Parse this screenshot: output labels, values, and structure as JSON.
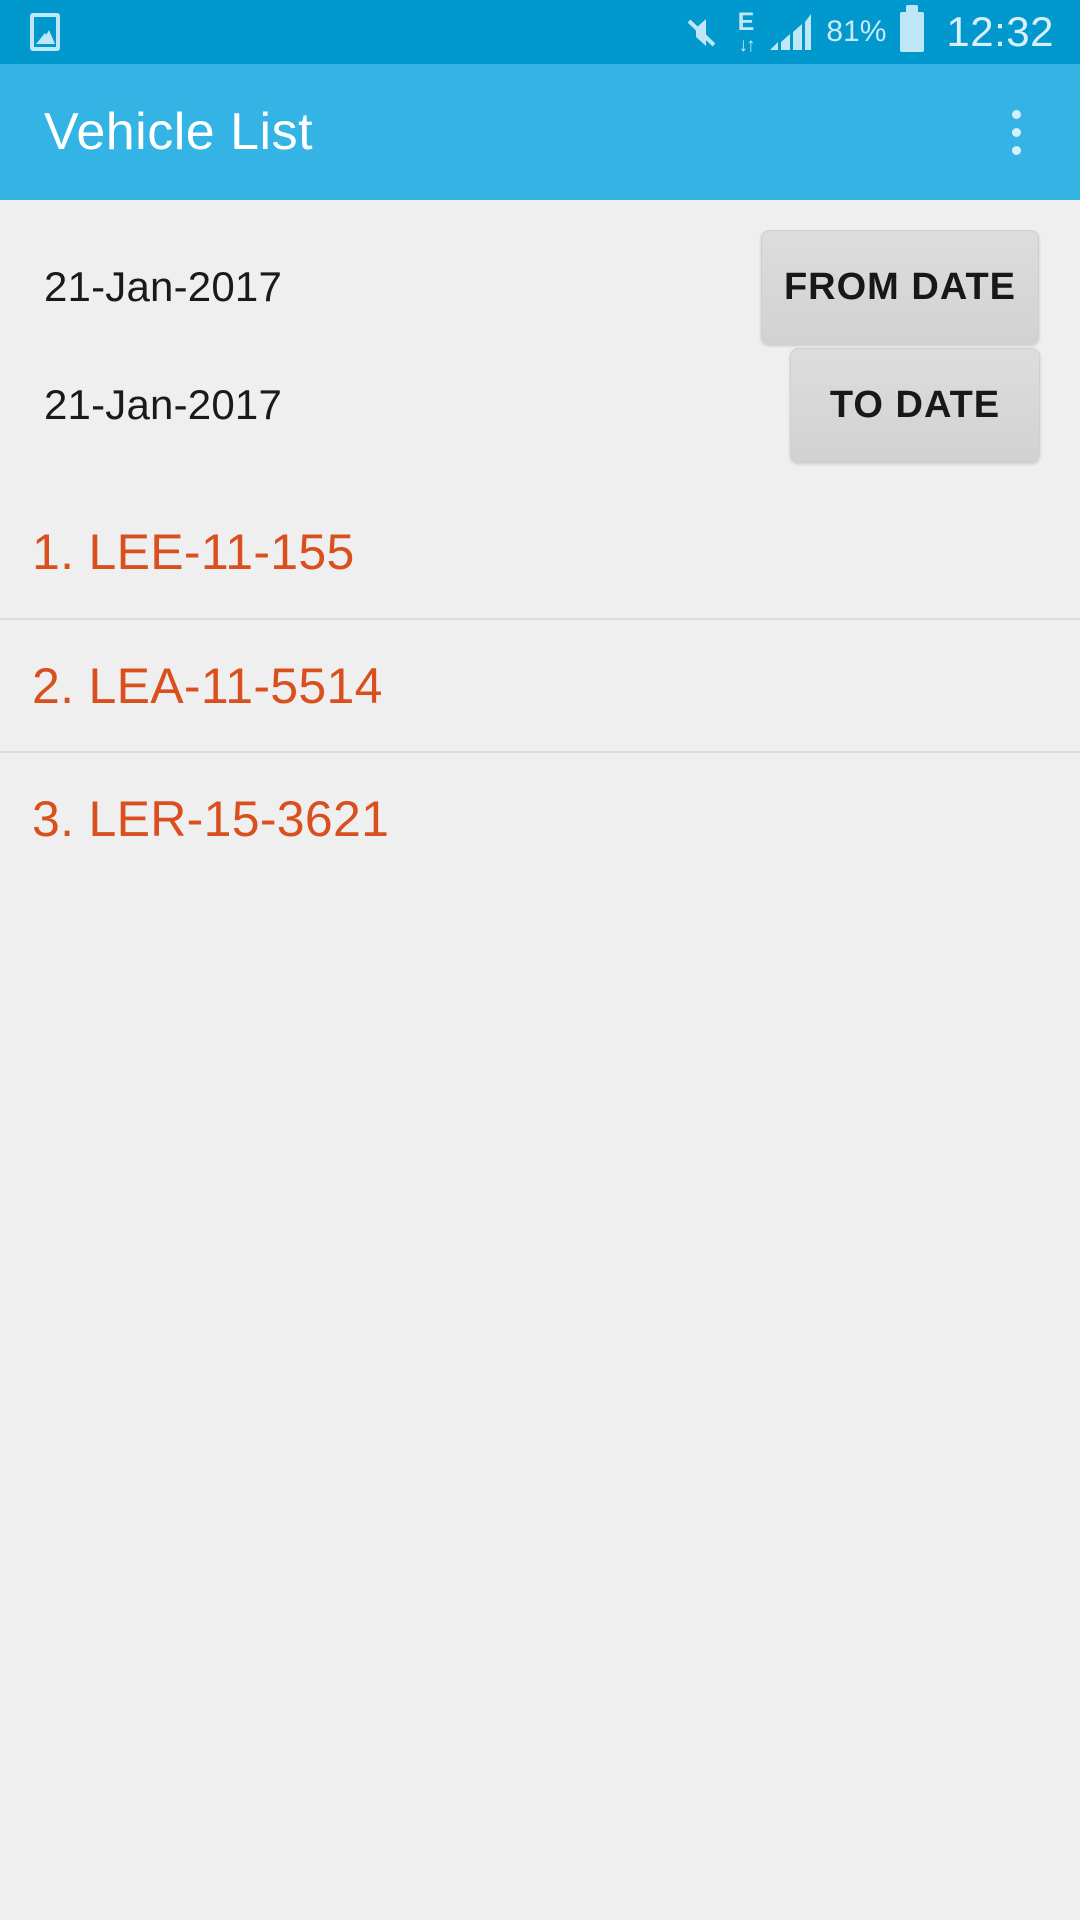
{
  "status_bar": {
    "notification_icon": "screenshot-icon",
    "icons": [
      "mute-icon",
      "edge-data-icon",
      "signal-icon"
    ],
    "edge_letter": "E",
    "edge_arrows": "↓↑",
    "battery_percent": "81%",
    "battery_icon": "battery-icon",
    "time": "12:32",
    "background_color": "#0098cd"
  },
  "app_bar": {
    "title": "Vehicle List",
    "overflow_icon": "overflow-menu-icon",
    "background_color": "#33b4e5",
    "title_color": "#ffffff"
  },
  "filters": {
    "from": {
      "date_value": "21-Jan-2017",
      "button_label": "FROM DATE"
    },
    "to": {
      "date_value": "21-Jan-2017",
      "button_label": "TO DATE"
    }
  },
  "vehicle_list": {
    "accent_color": "#d9501e",
    "items": [
      {
        "label": "1. LEE-11-155"
      },
      {
        "label": "2. LEA-11-5514"
      },
      {
        "label": "3. LER-15-3621"
      }
    ]
  }
}
